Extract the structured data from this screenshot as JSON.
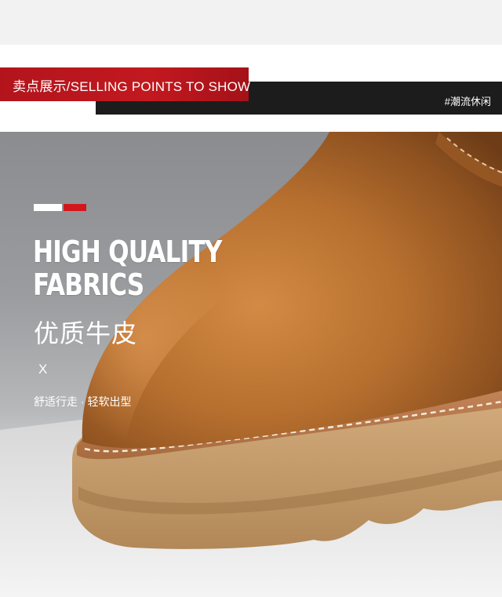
{
  "header": {
    "section_title": "卖点展示/SELLING POINTS TO SHOW",
    "tag": "#潮流休闲"
  },
  "feature": {
    "headline_line1": "HIGH QUALITY",
    "headline_line2": "FABRICS",
    "title_cn": "优质牛皮",
    "separator": "X",
    "subtitle": "舒适行走 · 轻软出型"
  },
  "colors": {
    "accent_red": "#c2191f",
    "bar_black": "#1c1c1c",
    "leather": "#b8702f",
    "sole": "#c9a071"
  }
}
